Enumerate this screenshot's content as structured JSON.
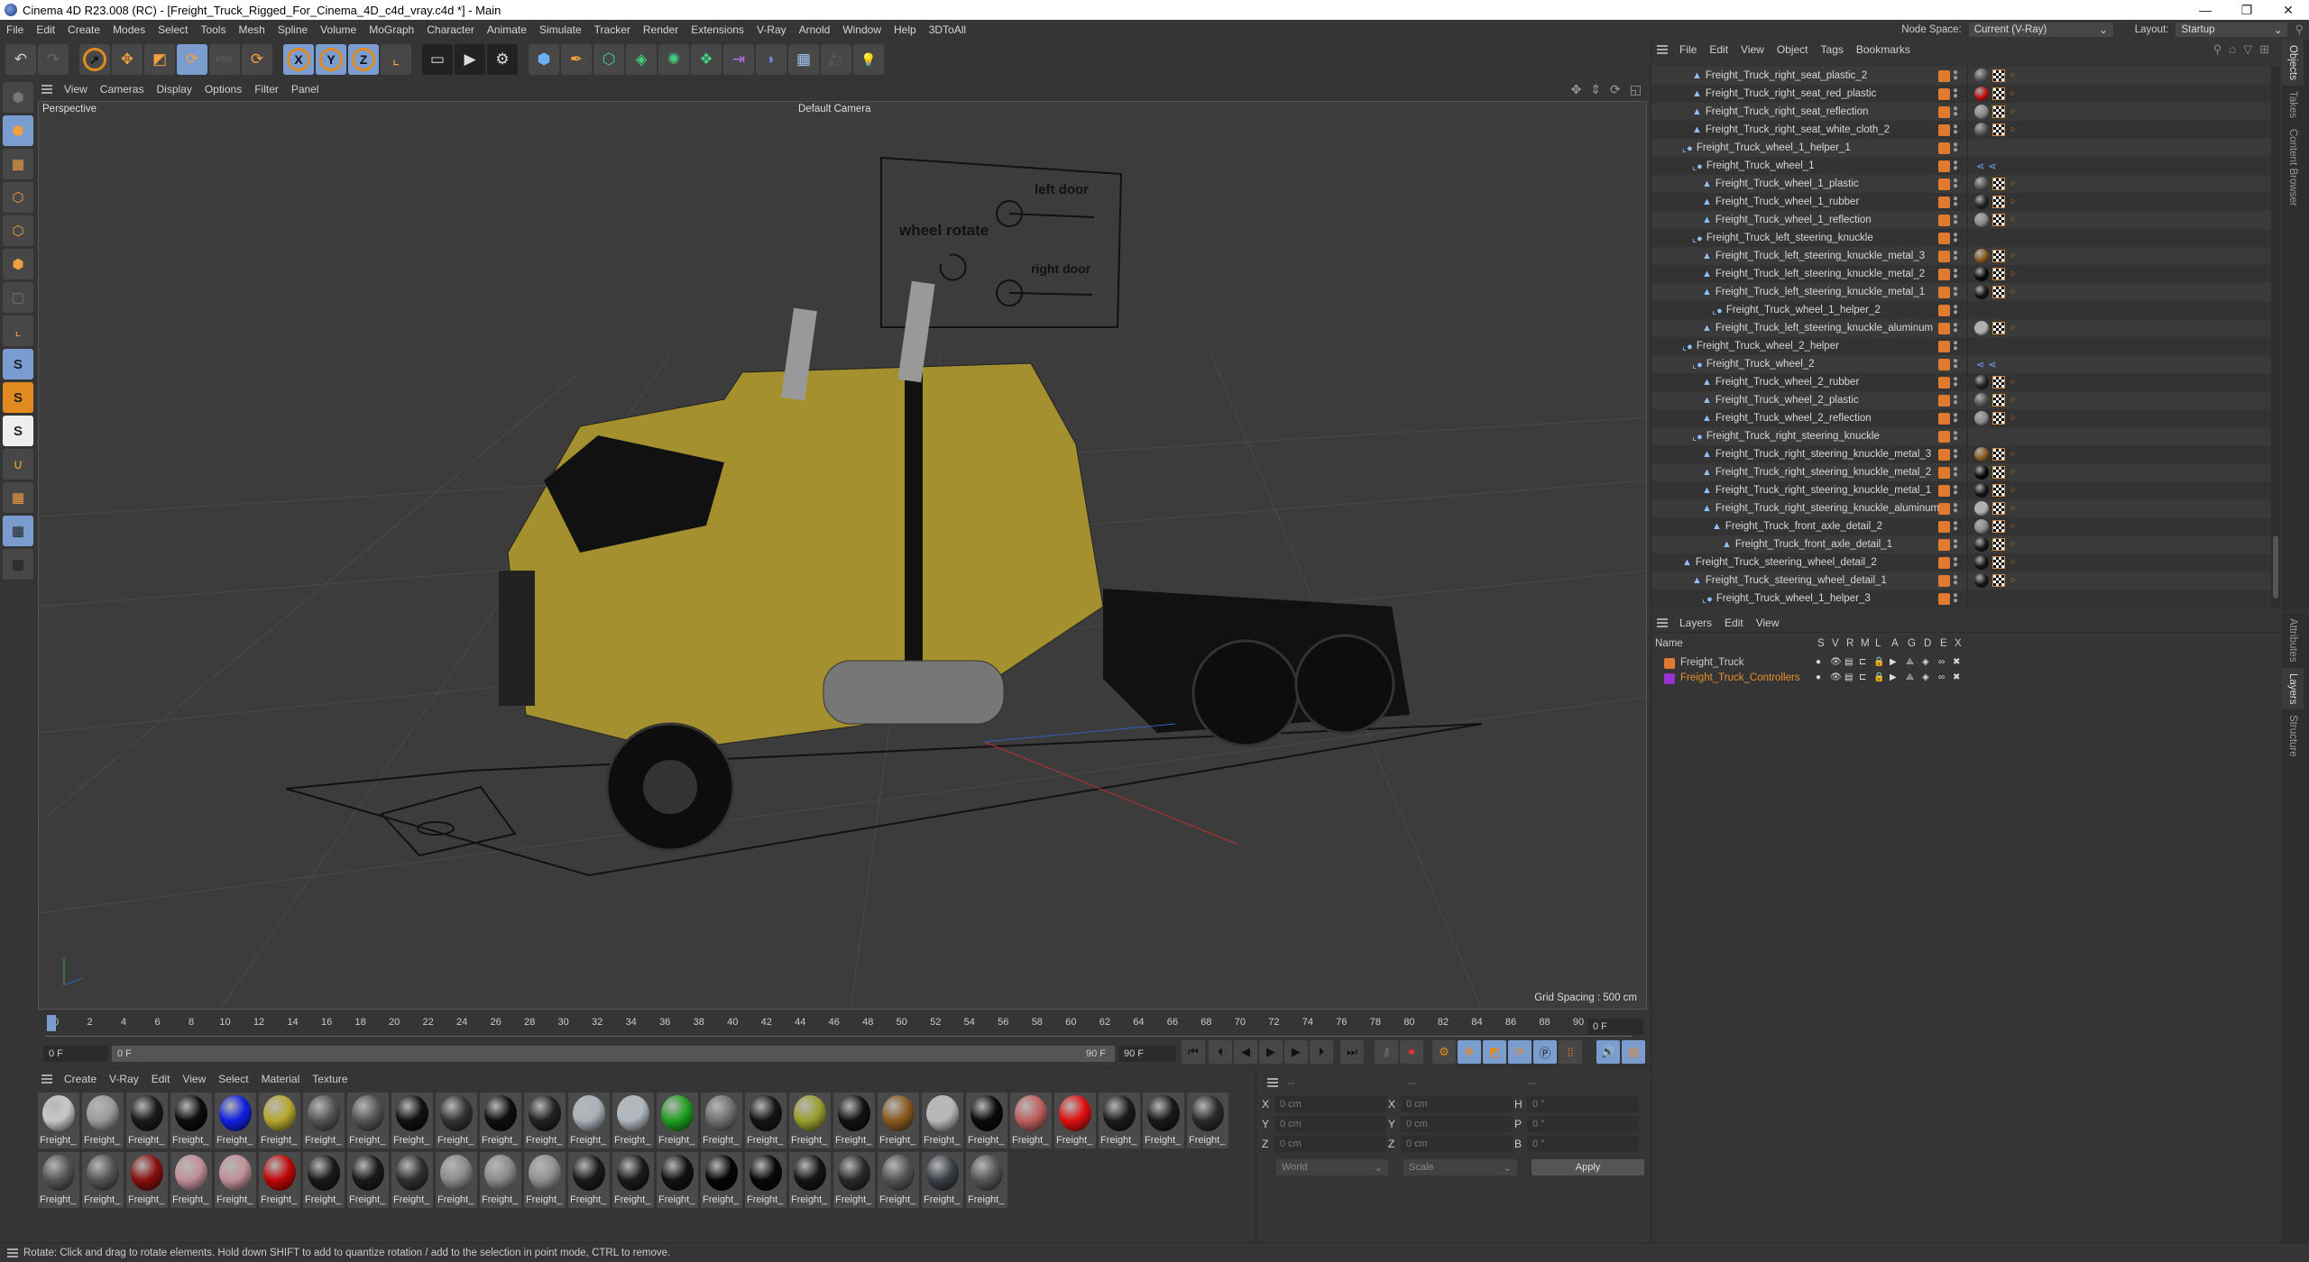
{
  "window": {
    "title": "Cinema 4D R23.008 (RC) - [Freight_Truck_Rigged_For_Cinema_4D_c4d_vray.c4d *] - Main",
    "minimize": "—",
    "restore": "❐",
    "close": "✕"
  },
  "menubar": {
    "items": [
      "File",
      "Edit",
      "Create",
      "Modes",
      "Select",
      "Tools",
      "Mesh",
      "Spline",
      "Volume",
      "MoGraph",
      "Character",
      "Animate",
      "Simulate",
      "Tracker",
      "Render",
      "Extensions",
      "V-Ray",
      "Arnold",
      "Window",
      "Help",
      "3DToAll"
    ],
    "node_space_label": "Node Space:",
    "node_space_value": "Current (V-Ray)",
    "layout_label": "Layout:",
    "layout_value": "Startup"
  },
  "toolbar": {
    "undo": "↶",
    "redo": "↷",
    "select": "➚",
    "move": "✥",
    "scale": "◩",
    "rotate": "⟳",
    "psr": "PSR",
    "recent": "⟳",
    "axis_x": "X",
    "axis_y": "Y",
    "axis_z": "Z",
    "coord": "⌞",
    "render_view": "▭",
    "render": "▶",
    "render_settings": "⚙",
    "cube": "⬢",
    "pen": "✒",
    "subdiv": "⬡",
    "extrude": "◈",
    "mograph": "✺",
    "cloner": "❖",
    "deformer": "⇥",
    "field": "◗",
    "floor": "▦",
    "camera": "🎥",
    "light": "💡"
  },
  "lefttools": [
    "⬢",
    "▦",
    "⬡",
    "⬡",
    "⬢",
    "▢",
    "⌞",
    "S",
    "S",
    "S",
    "∪",
    "▦",
    "▦",
    "▦"
  ],
  "viewport": {
    "menu": [
      "View",
      "Cameras",
      "Display",
      "Options",
      "Filter",
      "Panel"
    ],
    "projection": "Perspective",
    "camera": "Default Camera",
    "grid_spacing": "Grid Spacing : 500 cm",
    "controller_labels": {
      "left_door": "left door",
      "wheel_rotate": "wheel rotate",
      "right_door": "right door"
    }
  },
  "timeline": {
    "ticks": [
      "0",
      "2",
      "4",
      "6",
      "8",
      "10",
      "12",
      "14",
      "16",
      "18",
      "20",
      "22",
      "24",
      "26",
      "28",
      "30",
      "32",
      "34",
      "36",
      "38",
      "40",
      "42",
      "44",
      "46",
      "48",
      "50",
      "52",
      "54",
      "56",
      "58",
      "60",
      "62",
      "64",
      "66",
      "68",
      "70",
      "72",
      "74",
      "76",
      "78",
      "80",
      "82",
      "84",
      "86",
      "88",
      "90"
    ],
    "current_frame": "0 F",
    "start_field": "0 F",
    "range_start": "0 F",
    "range_end": "90 F",
    "end_field": "90 F",
    "right_frame": "0 F",
    "buttons": {
      "first": "⏮",
      "prev_key": "⏴",
      "prev": "◀",
      "play": "▶",
      "next": "▶",
      "next_key": "⏵",
      "last": "⏭"
    }
  },
  "materials": {
    "menu": [
      "Create",
      "V-Ray",
      "Edit",
      "View",
      "Select",
      "Material",
      "Texture"
    ],
    "label": "Freight_",
    "items": [
      {
        "color": "#c8c8c8"
      },
      {
        "color": "#9a9a9a"
      },
      {
        "color": "#1a1a1a"
      },
      {
        "color": "#0c0c0c"
      },
      {
        "color": "#1020e0"
      },
      {
        "color": "#b8a830"
      },
      {
        "color": "#555555"
      },
      {
        "color": "#555555"
      },
      {
        "color": "#111111"
      },
      {
        "color": "#333333"
      },
      {
        "color": "#0e0e0e"
      },
      {
        "color": "#222222"
      },
      {
        "color": "#aab0b8"
      },
      {
        "color": "#b0b8c0"
      },
      {
        "color": "#20a020"
      },
      {
        "color": "#707070"
      },
      {
        "color": "#151515"
      },
      {
        "color": "#9aa030"
      },
      {
        "color": "#121212"
      },
      {
        "color": "#8a5a20"
      },
      {
        "color": "#b8b8b8"
      },
      {
        "color": "#0a0a0a"
      },
      {
        "color": "#c06060"
      },
      {
        "color": "#e01010"
      },
      {
        "color": "#1c1c1c"
      },
      {
        "color": "#181818"
      },
      {
        "color": "#2a2a2a"
      },
      {
        "color": "#555555"
      },
      {
        "color": "#555555"
      },
      {
        "color": "#8a1010"
      },
      {
        "color": "#c09098"
      },
      {
        "color": "#c09098"
      },
      {
        "color": "#c00808"
      },
      {
        "color": "#1a1a1a"
      },
      {
        "color": "#1a1a1a"
      },
      {
        "color": "#303030"
      },
      {
        "color": "#8a8a8a"
      },
      {
        "color": "#8a8a8a"
      },
      {
        "color": "#909090"
      },
      {
        "color": "#1a1a1a"
      },
      {
        "color": "#1a1a1a"
      },
      {
        "color": "#111111"
      },
      {
        "color": "#050505"
      },
      {
        "color": "#080808"
      },
      {
        "color": "#141414"
      },
      {
        "color": "#2a2a2a"
      },
      {
        "color": "#555555"
      },
      {
        "color": "#3a4048"
      },
      {
        "color": "#555555"
      }
    ]
  },
  "coords": {
    "headers": [
      "--",
      "--",
      "--"
    ],
    "rows": [
      {
        "l1": "X",
        "v1": "0 cm",
        "l2": "X",
        "v2": "0 cm",
        "l3": "H",
        "v3": "0 °"
      },
      {
        "l1": "Y",
        "v1": "0 cm",
        "l2": "Y",
        "v2": "0 cm",
        "l3": "P",
        "v3": "0 °"
      },
      {
        "l1": "Z",
        "v1": "0 cm",
        "l2": "Z",
        "v2": "0 cm",
        "l3": "B",
        "v3": "0 °"
      }
    ],
    "space": "World",
    "mode": "Scale",
    "apply": "Apply"
  },
  "objects": {
    "menu": [
      "File",
      "Edit",
      "View",
      "Object",
      "Tags",
      "Bookmarks"
    ],
    "rows": [
      {
        "name": "Freight_Truck_right_seat_plastic_2",
        "indent": 3,
        "type": "mesh",
        "mat": "#555"
      },
      {
        "name": "Freight_Truck_right_seat_red_plastic",
        "indent": 3,
        "type": "mesh",
        "mat": "#c01010"
      },
      {
        "name": "Freight_Truck_right_seat_reflection",
        "indent": 3,
        "type": "mesh",
        "mat": "#8a8a8a"
      },
      {
        "name": "Freight_Truck_right_seat_white_cloth_2",
        "indent": 3,
        "type": "mesh",
        "mat": "#555"
      },
      {
        "name": "Freight_Truck_wheel_1_helper_1",
        "indent": 2,
        "type": "null",
        "mat": ""
      },
      {
        "name": "Freight_Truck_wheel_1",
        "indent": 3,
        "type": "null",
        "mat": "spline"
      },
      {
        "name": "Freight_Truck_wheel_1_plastic",
        "indent": 4,
        "type": "mesh",
        "mat": "#555"
      },
      {
        "name": "Freight_Truck_wheel_1_rubber",
        "indent": 4,
        "type": "mesh",
        "mat": "#222"
      },
      {
        "name": "Freight_Truck_wheel_1_reflection",
        "indent": 4,
        "type": "mesh",
        "mat": "#8a8a8a"
      },
      {
        "name": "Freight_Truck_left_steering_knuckle",
        "indent": 3,
        "type": "null",
        "mat": ""
      },
      {
        "name": "Freight_Truck_left_steering_knuckle_metal_3",
        "indent": 4,
        "type": "mesh",
        "mat": "#8a5a20"
      },
      {
        "name": "Freight_Truck_left_steering_knuckle_metal_2",
        "indent": 4,
        "type": "mesh",
        "mat": "#0a0a0a"
      },
      {
        "name": "Freight_Truck_left_steering_knuckle_metal_1",
        "indent": 4,
        "type": "mesh",
        "mat": "#151515"
      },
      {
        "name": "Freight_Truck_wheel_1_helper_2",
        "indent": 5,
        "type": "null",
        "mat": ""
      },
      {
        "name": "Freight_Truck_left_steering_knuckle_aluminum",
        "indent": 4,
        "type": "mesh",
        "mat": "#b0b0b0"
      },
      {
        "name": "Freight_Truck_wheel_2_helper",
        "indent": 2,
        "type": "null",
        "mat": ""
      },
      {
        "name": "Freight_Truck_wheel_2",
        "indent": 3,
        "type": "null",
        "mat": "spline"
      },
      {
        "name": "Freight_Truck_wheel_2_rubber",
        "indent": 4,
        "type": "mesh",
        "mat": "#222"
      },
      {
        "name": "Freight_Truck_wheel_2_plastic",
        "indent": 4,
        "type": "mesh",
        "mat": "#555"
      },
      {
        "name": "Freight_Truck_wheel_2_reflection",
        "indent": 4,
        "type": "mesh",
        "mat": "#8a8a8a"
      },
      {
        "name": "Freight_Truck_right_steering_knuckle",
        "indent": 3,
        "type": "null",
        "mat": ""
      },
      {
        "name": "Freight_Truck_right_steering_knuckle_metal_3",
        "indent": 4,
        "type": "mesh",
        "mat": "#8a5a20"
      },
      {
        "name": "Freight_Truck_right_steering_knuckle_metal_2",
        "indent": 4,
        "type": "mesh",
        "mat": "#0a0a0a"
      },
      {
        "name": "Freight_Truck_right_steering_knuckle_metal_1",
        "indent": 4,
        "type": "mesh",
        "mat": "#151515"
      },
      {
        "name": "Freight_Truck_right_steering_knuckle_aluminum",
        "indent": 4,
        "type": "mesh",
        "mat": "#b0b0b0"
      },
      {
        "name": "Freight_Truck_front_axle_detail_2",
        "indent": 5,
        "type": "mesh",
        "mat": "#8a8a8a"
      },
      {
        "name": "Freight_Truck_front_axle_detail_1",
        "indent": 6,
        "type": "mesh",
        "mat": "#151515"
      },
      {
        "name": "Freight_Truck_steering_wheel_detail_2",
        "indent": 2,
        "type": "mesh",
        "mat": "#151515"
      },
      {
        "name": "Freight_Truck_steering_wheel_detail_1",
        "indent": 3,
        "type": "mesh",
        "mat": "#151515"
      },
      {
        "name": "Freight_Truck_wheel_1_helper_3",
        "indent": 4,
        "type": "null",
        "mat": ""
      }
    ]
  },
  "layers": {
    "menu": [
      "Layers",
      "Edit",
      "View"
    ],
    "columns": [
      "Name",
      "S",
      "V",
      "R",
      "M",
      "L",
      "A",
      "G",
      "D",
      "E",
      "X"
    ],
    "rows": [
      {
        "name": "Freight_Truck",
        "color": "#e07a2e",
        "text_color": "#d0d0d0"
      },
      {
        "name": "Freight_Truck_Controllers",
        "color": "#9a30d0",
        "text_color": "#e8902a"
      }
    ]
  },
  "side_tabs_top": [
    "Objects",
    "Takes",
    "Content Browser"
  ],
  "side_tabs_bottom": [
    "Attributes",
    "Layers",
    "Structure"
  ],
  "status": "Rotate: Click and drag to rotate elements. Hold down SHIFT to add to quantize rotation / add to the selection in point mode, CTRL to remove."
}
